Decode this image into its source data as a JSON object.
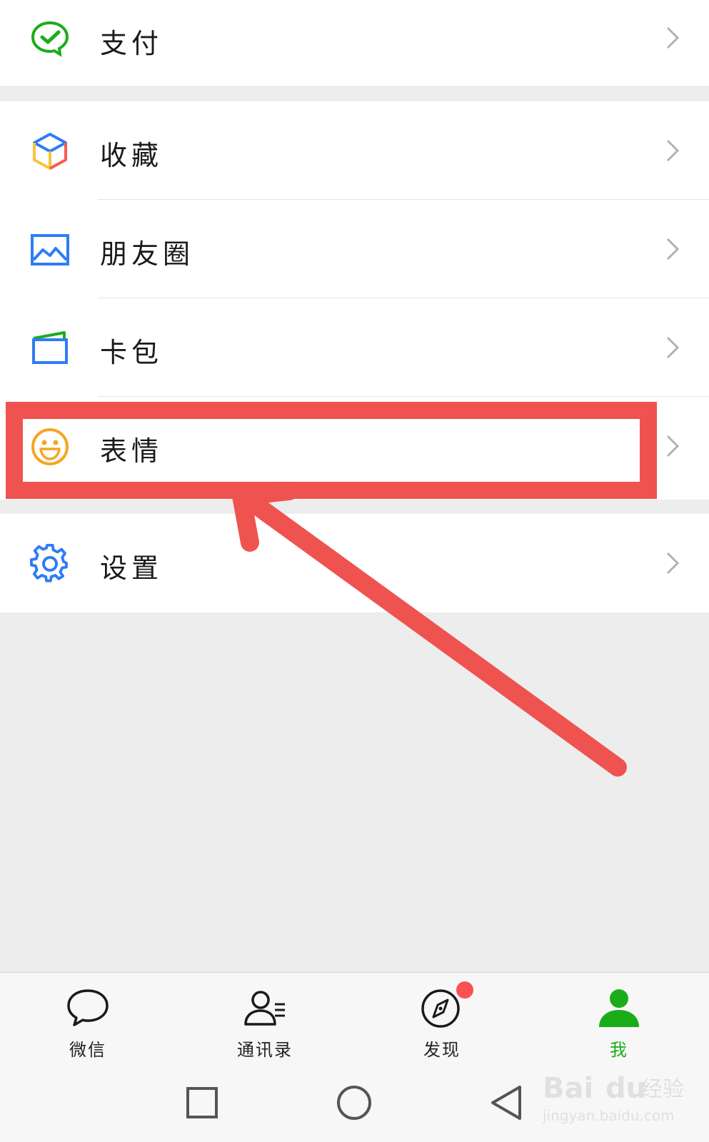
{
  "menu": {
    "pay": {
      "label": "支付",
      "icon": "wechat-pay-icon"
    },
    "favorites": {
      "label": "收藏",
      "icon": "cube-icon"
    },
    "moments": {
      "label": "朋友圈",
      "icon": "picture-icon"
    },
    "cards": {
      "label": "卡包",
      "icon": "wallet-icon"
    },
    "stickers": {
      "label": "表情",
      "icon": "smiley-icon"
    },
    "settings": {
      "label": "设置",
      "icon": "gear-icon"
    }
  },
  "tabbar": {
    "chats": "微信",
    "contacts": "通讯录",
    "discover": "发现",
    "me": "我",
    "active": "me",
    "discover_badge": true
  },
  "annotation": {
    "color": "#ef5350",
    "target": "stickers"
  },
  "watermark": {
    "brand": "Bai",
    "brand2": "du",
    "tag": "经验",
    "url": "jingyan.baidu.com"
  },
  "colors": {
    "accent": "#1aad19",
    "background": "#ededed",
    "badge": "#fa5151"
  }
}
